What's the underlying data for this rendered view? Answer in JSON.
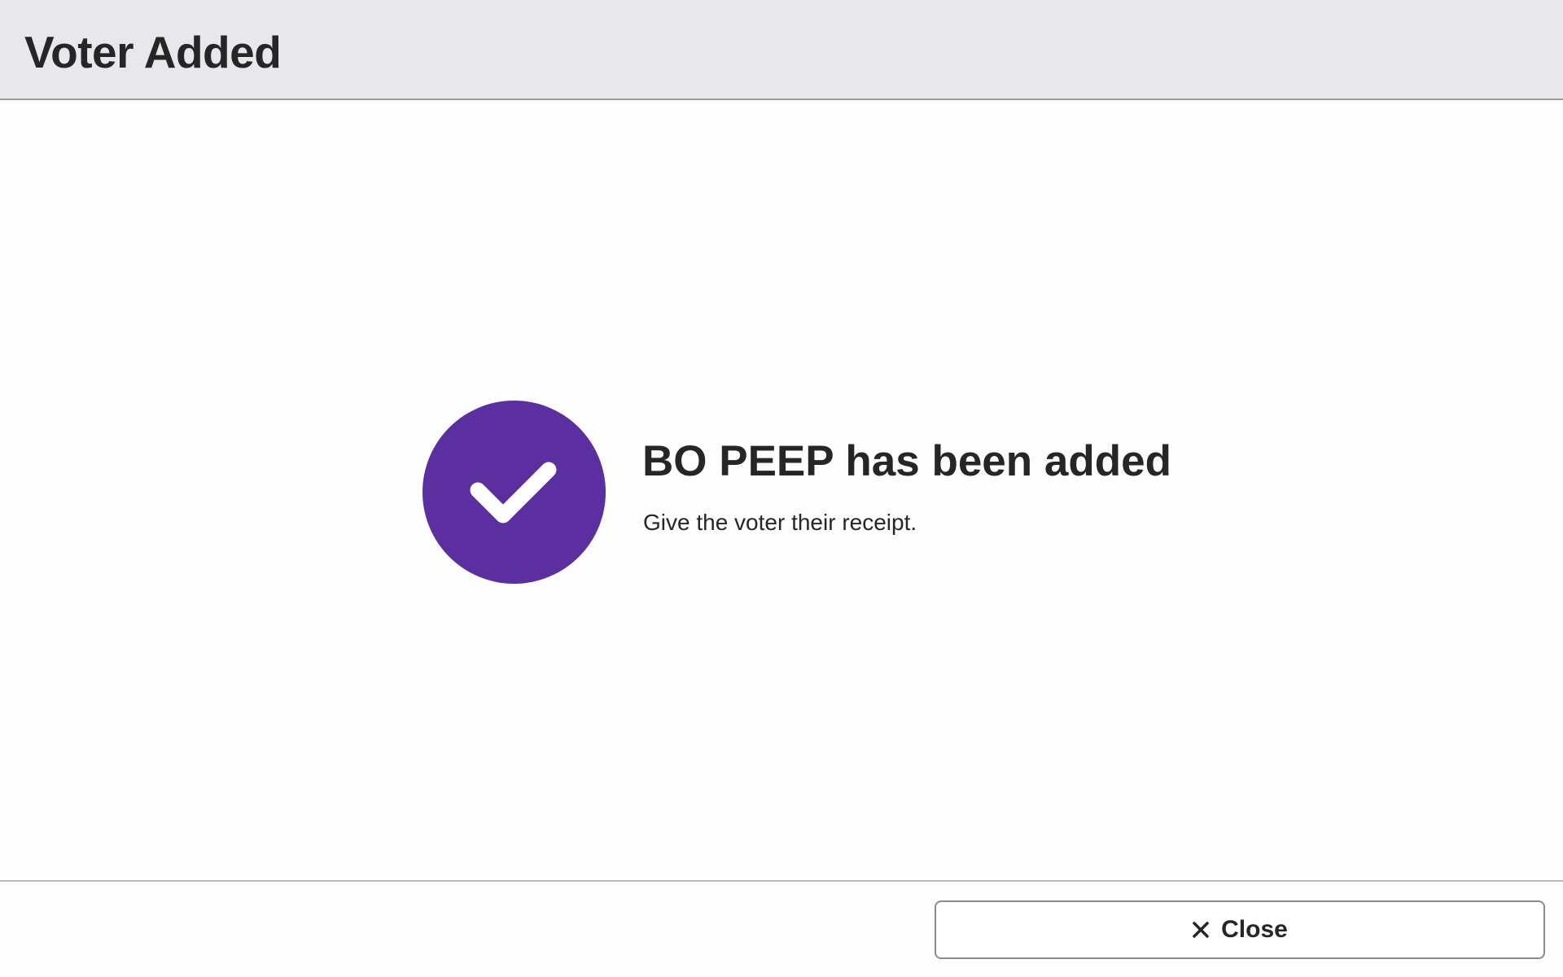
{
  "header": {
    "title": "Voter Added"
  },
  "main": {
    "message_title": "BO PEEP has been added",
    "message_body": "Give the voter their receipt.",
    "icon": "check-circle-icon",
    "accent_color": "#5b2fa0"
  },
  "footer": {
    "close_label": "Close",
    "close_icon": "close-icon"
  }
}
